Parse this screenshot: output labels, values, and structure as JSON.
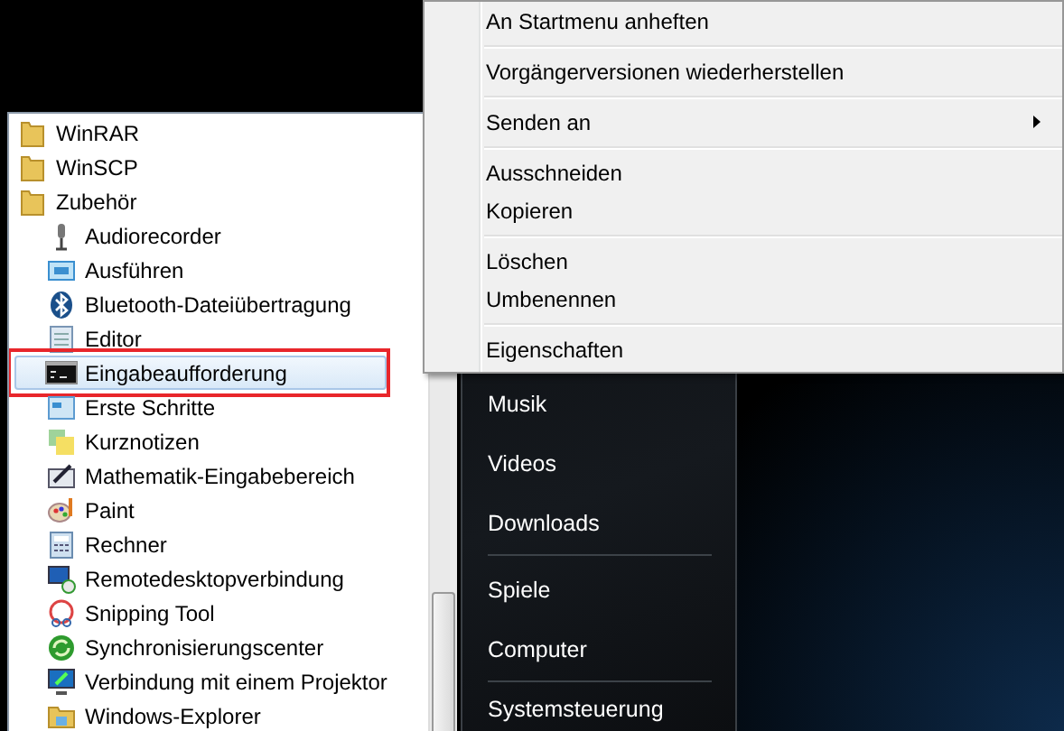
{
  "program_list": {
    "items": [
      {
        "label": "WinRAR",
        "selected": false
      },
      {
        "label": "WinSCP",
        "selected": false
      },
      {
        "label": "Zubehör",
        "selected": false,
        "children": [
          {
            "label": "Audiorecorder",
            "selected": false
          },
          {
            "label": "Ausführen",
            "selected": false
          },
          {
            "label": "Bluetooth-Dateiübertragung",
            "selected": false
          },
          {
            "label": "Editor",
            "selected": false
          },
          {
            "label": "Eingabeaufforderung",
            "selected": true
          },
          {
            "label": "Erste Schritte",
            "selected": false
          },
          {
            "label": "Kurznotizen",
            "selected": false
          },
          {
            "label": "Mathematik-Eingabebereich",
            "selected": false
          },
          {
            "label": "Paint",
            "selected": false
          },
          {
            "label": "Rechner",
            "selected": false
          },
          {
            "label": "Remotedesktopverbindung",
            "selected": false
          },
          {
            "label": "Snipping Tool",
            "selected": false
          },
          {
            "label": "Synchronisierungscenter",
            "selected": false
          },
          {
            "label": "Verbindung mit einem Projektor",
            "selected": false
          },
          {
            "label": "Windows-Explorer",
            "selected": false
          }
        ]
      }
    ]
  },
  "places": [
    {
      "kind": "item",
      "label": "Musik"
    },
    {
      "kind": "item",
      "label": "Videos"
    },
    {
      "kind": "item",
      "label": "Downloads"
    },
    {
      "kind": "separator"
    },
    {
      "kind": "item",
      "label": "Spiele"
    },
    {
      "kind": "item",
      "label": "Computer"
    },
    {
      "kind": "separator"
    },
    {
      "kind": "item",
      "label": "Systemsteuerung"
    }
  ],
  "context_menu": [
    {
      "kind": "item",
      "label": "An Startmenu anheften",
      "submenu": false
    },
    {
      "kind": "separator"
    },
    {
      "kind": "item",
      "label": "Vorgängerversionen wiederherstellen",
      "submenu": false
    },
    {
      "kind": "separator"
    },
    {
      "kind": "item",
      "label": "Senden an",
      "submenu": true
    },
    {
      "kind": "separator"
    },
    {
      "kind": "item",
      "label": "Ausschneiden",
      "submenu": false
    },
    {
      "kind": "item",
      "label": "Kopieren",
      "submenu": false
    },
    {
      "kind": "separator"
    },
    {
      "kind": "item",
      "label": "Löschen",
      "submenu": false
    },
    {
      "kind": "item",
      "label": "Umbenennen",
      "submenu": false
    },
    {
      "kind": "separator"
    },
    {
      "kind": "item",
      "label": "Eigenschaften",
      "submenu": false
    }
  ]
}
